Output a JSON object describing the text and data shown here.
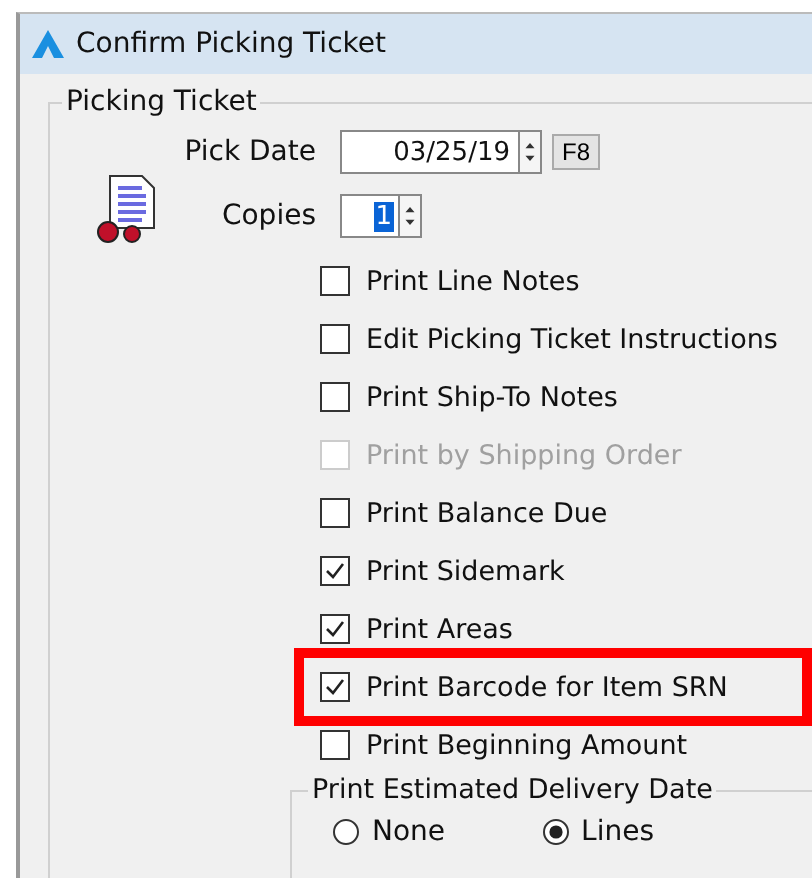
{
  "window": {
    "title": "Confirm Picking Ticket"
  },
  "group": {
    "title": "Picking Ticket"
  },
  "pick_date": {
    "label": "Pick Date",
    "value": "03/25/19",
    "shortcut": "F8"
  },
  "copies": {
    "label": "Copies",
    "value": "1"
  },
  "options": [
    {
      "label": "Print Line Notes",
      "checked": false,
      "disabled": false,
      "highlighted": false
    },
    {
      "label": "Edit Picking Ticket Instructions",
      "checked": false,
      "disabled": false,
      "highlighted": false
    },
    {
      "label": "Print Ship-To Notes",
      "checked": false,
      "disabled": false,
      "highlighted": false
    },
    {
      "label": "Print by Shipping Order",
      "checked": false,
      "disabled": true,
      "highlighted": false
    },
    {
      "label": "Print Balance Due",
      "checked": false,
      "disabled": false,
      "highlighted": false
    },
    {
      "label": "Print Sidemark",
      "checked": true,
      "disabled": false,
      "highlighted": false
    },
    {
      "label": "Print Areas",
      "checked": true,
      "disabled": false,
      "highlighted": false
    },
    {
      "label": "Print Barcode for Item SRN",
      "checked": true,
      "disabled": false,
      "highlighted": true
    },
    {
      "label": "Print Beginning Amount",
      "checked": false,
      "disabled": false,
      "highlighted": false
    }
  ],
  "delivery_date": {
    "title": "Print Estimated Delivery Date",
    "choices": [
      {
        "label": "None",
        "selected": false
      },
      {
        "label": "Lines",
        "selected": true
      }
    ]
  }
}
